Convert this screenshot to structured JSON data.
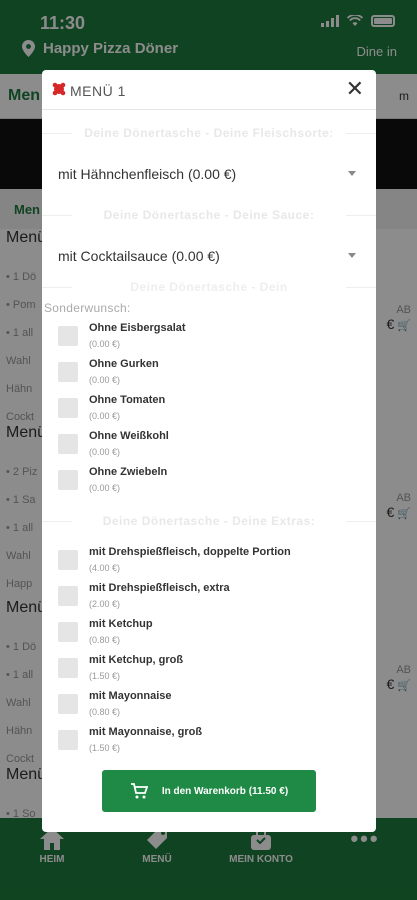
{
  "status": {
    "time": "11:30"
  },
  "header": {
    "store_name": "Happy Pizza Döner",
    "mode": "Dine in"
  },
  "background": {
    "tab_label": "Men",
    "tab_right": "m",
    "sub_label": "Men",
    "items": [
      {
        "title": "Menü",
        "lines": [
          "• 1 Dö",
          "• Pom",
          "• 1 all",
          "Wahl",
          "Hähn",
          "Cockt"
        ],
        "ab": "AB",
        "price": "€"
      },
      {
        "title": "Menü",
        "lines": [
          "• 2 Piz",
          "• 1 Sa",
          "• 1 all",
          "Wahl",
          "Happ"
        ],
        "ab": "AB",
        "price": "€"
      },
      {
        "title": "Menü",
        "lines": [
          "• 1 Dö",
          "• 1 all",
          "Wahl",
          "Hähn",
          "Cockt"
        ],
        "ab": "AB",
        "price": "€"
      },
      {
        "title": "Menü",
        "lines": [
          "• 1 So"
        ]
      }
    ]
  },
  "modal": {
    "title": "MENÜ 1",
    "close": "✕",
    "section1": "Deine Dönertasche - Deine Fleischsorte:",
    "select1": "mit Hähnchenfleisch (0.00 €)",
    "section2": "Deine Dönertasche - Deine Sauce:",
    "select2": "mit Cocktailsauce (0.00 €)",
    "section3": "Deine Dönertasche - Dein",
    "sonderwunsch_label": "Sonderwunsch:",
    "sonderwunsch": [
      {
        "name": "Ohne Eisbergsalat",
        "price": "(0.00 €)"
      },
      {
        "name": "Ohne Gurken",
        "price": "(0.00 €)"
      },
      {
        "name": "Ohne Tomaten",
        "price": "(0.00 €)"
      },
      {
        "name": "Ohne Weißkohl",
        "price": "(0.00 €)"
      },
      {
        "name": "Ohne Zwiebeln",
        "price": "(0.00 €)"
      }
    ],
    "section4": "Deine Dönertasche - Deine Extras:",
    "extras": [
      {
        "name": "mit Drehspießfleisch, doppelte Portion",
        "price": "(4.00 €)"
      },
      {
        "name": "mit Drehspießfleisch, extra",
        "price": "(2.00 €)"
      },
      {
        "name": "mit Ketchup",
        "price": "(0.80 €)"
      },
      {
        "name": "mit Ketchup, groß",
        "price": "(1.50 €)"
      },
      {
        "name": "mit Mayonnaise",
        "price": "(0.80 €)"
      },
      {
        "name": "mit Mayonnaise, groß",
        "price": "(1.50 €)"
      }
    ],
    "cart_button": "In den Warenkorb (11.50 €)"
  },
  "nav": [
    {
      "label": "HEIM",
      "icon": "home-icon"
    },
    {
      "label": "MENÜ",
      "icon": "tag-icon"
    },
    {
      "label": "MEIN KONTO",
      "icon": "bag-icon"
    },
    {
      "label": "",
      "icon": "more-icon"
    }
  ],
  "colors": {
    "brand": "#1e7b3d",
    "button": "#1f8a45"
  }
}
